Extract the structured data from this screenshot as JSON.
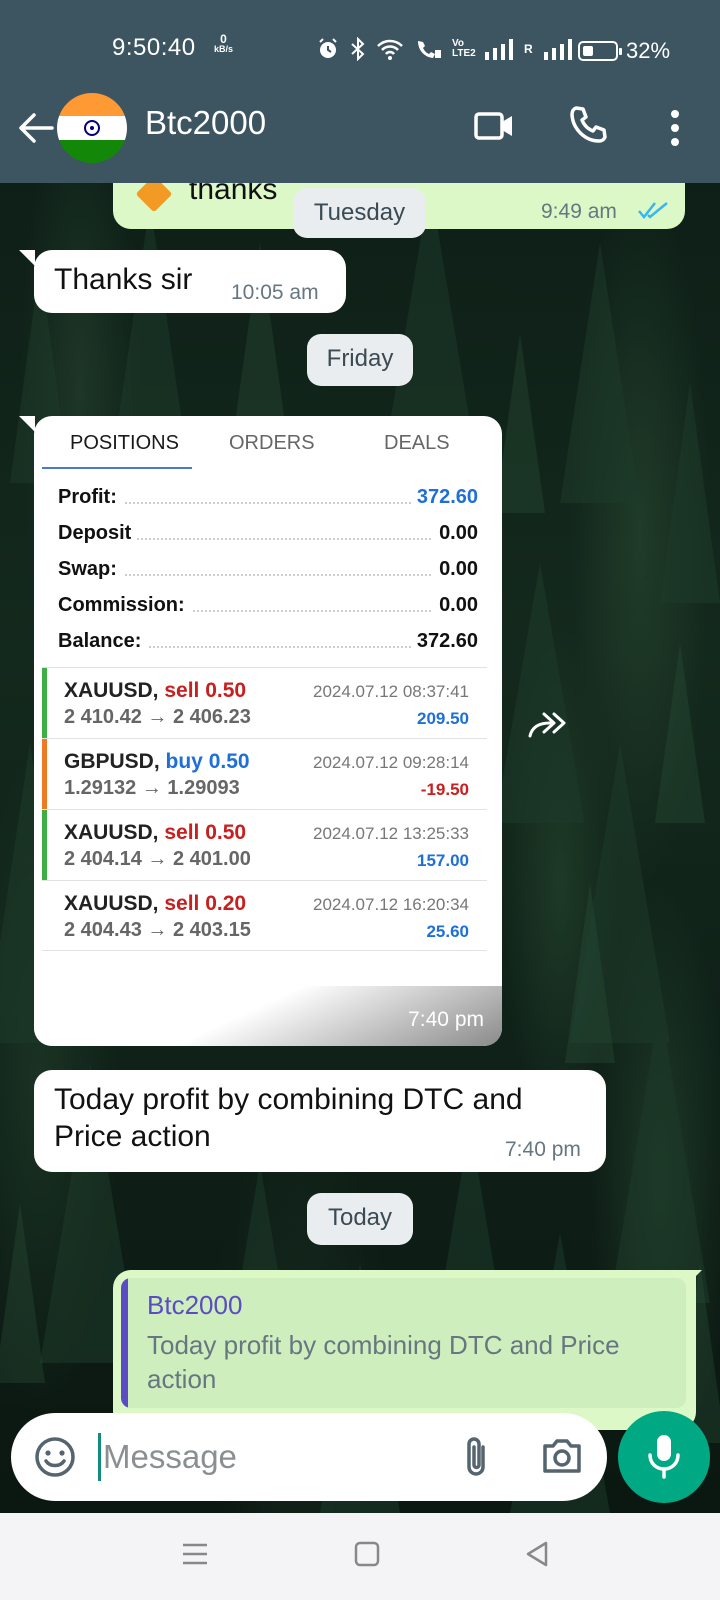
{
  "status_bar": {
    "time": "9:50:40",
    "net_speed_value": "0",
    "net_speed_unit": "kB/s",
    "volte": "Vo LTE2",
    "roaming": "R",
    "battery_pct": "32%",
    "icons": [
      "alarm-icon",
      "bluetooth-icon",
      "wifi-icon",
      "wifi-calling-icon",
      "volte-icon",
      "signal-icon",
      "signal-roaming-icon",
      "battery-icon"
    ]
  },
  "header": {
    "contact_name": "Btc2000",
    "avatar": "india-flag"
  },
  "chat": {
    "prev_message": {
      "text": "thanks",
      "time": "9:49 am",
      "ticks": "read"
    },
    "date_tuesday": "Tuesday",
    "msg_thanks": {
      "text": "Thanks sir",
      "time": "10:05 am"
    },
    "date_friday": "Friday",
    "image_card": {
      "tabs": [
        "POSITIONS",
        "ORDERS",
        "DEALS"
      ],
      "summary": [
        {
          "label": "Profit:",
          "value": "372.60"
        },
        {
          "label": "Deposit",
          "value": "0.00"
        },
        {
          "label": "Swap:",
          "value": "0.00"
        },
        {
          "label": "Commission:",
          "value": "0.00"
        },
        {
          "label": "Balance:",
          "value": "372.60"
        }
      ],
      "deals": [
        {
          "symbol": "XAUUSD,",
          "side": "sell 0.50",
          "prices": "2 410.42 → 2 406.23",
          "datetime": "2024.07.12 08:37:41",
          "pl": "209.50",
          "bar": "#3cb043"
        },
        {
          "symbol": "GBPUSD,",
          "side": "buy 0.50",
          "prices": "1.29132 → 1.29093",
          "datetime": "2024.07.12 09:28:14",
          "pl": "-19.50",
          "bar": "#f07a24"
        },
        {
          "symbol": "XAUUSD,",
          "side": "sell 0.50",
          "prices": "2 404.14 → 2 401.00",
          "datetime": "2024.07.12 13:25:33",
          "pl": "157.00",
          "bar": "#3cb043"
        },
        {
          "symbol": "XAUUSD,",
          "side": "sell 0.20",
          "prices": "2 404.43 → 2 403.15",
          "datetime": "2024.07.12 16:20:34",
          "pl": "25.60",
          "bar": ""
        }
      ],
      "time": "7:40 pm"
    },
    "msg_profit": {
      "line1": "Today profit by combining DTC and",
      "line2": "Price action",
      "time": "7:40 pm"
    },
    "date_today": "Today",
    "reply_quote": {
      "author": "Btc2000",
      "line1": "Today profit by combining DTC and Price",
      "line2": "action"
    }
  },
  "input": {
    "placeholder": "Message"
  },
  "colors": {
    "header_bg": "#3c5561",
    "outgoing_bubble": "#dcf8c6",
    "accent": "#00a884",
    "quote_author": "#5b4bc4",
    "loss": "#c62020",
    "gain": "#1e6fd6"
  }
}
